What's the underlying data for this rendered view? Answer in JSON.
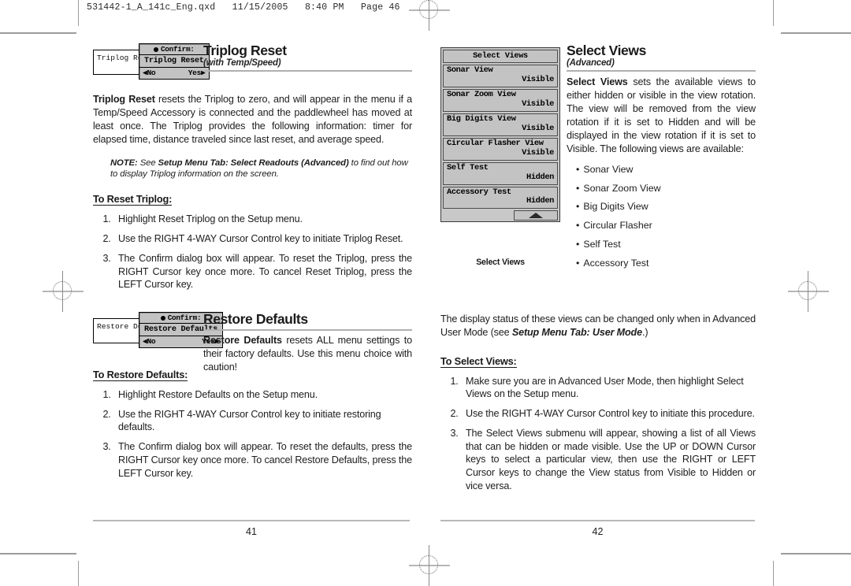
{
  "file_header": "531442-1_A_141c_Eng.qxd   11/15/2005   8:40 PM   Page 46",
  "left_page": {
    "page_number": "41",
    "triplog": {
      "heading": "Triplog Reset",
      "subheading": "(with Temp/Speed)",
      "lcd": {
        "underbox_label": "Triplog Rese",
        "confirm_title": "Confirm:",
        "confirm_body": "Triplog Reset",
        "btn_no": "◀No",
        "btn_yes": "Yes▶"
      },
      "body_bold_lead": "Triplog Reset",
      "body_rest": " resets the Triplog to zero, and will appear in the menu if a Temp/Speed Accessory is connected and the paddlewheel has moved at least once. The Triplog provides the following information: timer for elapsed time, distance traveled since last reset, and average speed.",
      "note_label": "NOTE:",
      "note_plain_1": "  See ",
      "note_bold": "Setup Menu Tab: Select Readouts (Advanced)",
      "note_plain_2": " to find out how to display Triplog information on the screen.",
      "steps_heading": "To Reset Triplog:",
      "steps": [
        "Highlight Reset Triplog on the Setup menu.",
        "Use the RIGHT 4-WAY Cursor Control key to initiate Triplog Reset.",
        "The Confirm dialog box will appear. To reset the Triplog, press the RIGHT Cursor key once more. To cancel Reset Triplog, press the LEFT Cursor key."
      ]
    },
    "restore": {
      "heading": "Restore Defaults",
      "lcd": {
        "underbox_label": "Restore De",
        "confirm_title": "Confirm:",
        "confirm_body": "Restore Defaults",
        "btn_no": "◀No",
        "btn_yes": "Yes▶"
      },
      "body_bold_lead": "Restore Defaults",
      "body_rest": " resets ALL menu settings to their factory defaults. Use this menu choice with caution!",
      "steps_heading": "To Restore Defaults:",
      "steps": [
        "Highlight Restore Defaults on the Setup menu.",
        "Use the RIGHT 4-WAY Cursor Control key to initiate restoring defaults.",
        "The Confirm dialog box will appear. To reset the defaults,  press the RIGHT Cursor key once more. To cancel Restore Defaults, press the LEFT Cursor key."
      ]
    }
  },
  "right_page": {
    "page_number": "42",
    "select_views": {
      "heading": "Select Views",
      "subheading": "(Advanced)",
      "body_bold_lead": "Select Views",
      "body_rest": " sets the available views to either hidden or visible in the view rotation. The view will be removed from the view rotation if it is set to Hidden and will be displayed in the view rotation if it is set to Visible. The following views are available:",
      "view_bullets": [
        "Sonar View",
        "Sonar Zoom View",
        "Big Digits View",
        "Circular Flasher",
        "Self Test",
        "Accessory Test"
      ],
      "lcd": {
        "title": "Select Views",
        "caption": "Select Views",
        "rows": [
          {
            "name": "Sonar View",
            "value": "Visible"
          },
          {
            "name": "Sonar Zoom View",
            "value": "Visible"
          },
          {
            "name": "Big Digits View",
            "value": "Visible"
          },
          {
            "name": "Circular Flasher View",
            "value": "Visible"
          },
          {
            "name": "Self Test",
            "value": "Hidden"
          },
          {
            "name": "Accessory Test",
            "value": "Hidden"
          }
        ],
        "scroll_icon": "scroll-up-arrow"
      },
      "advanced_note_plain_1": "The display status of these views can be changed only when in Advanced User Mode (see ",
      "advanced_note_bold": "Setup Menu Tab: User Mode",
      "advanced_note_plain_2": ".)",
      "steps_heading": "To Select Views:",
      "steps": [
        "Make sure you are in Advanced User Mode, then highlight Select Views on the Setup menu.",
        "Use the RIGHT 4-WAY Cursor Control key to initiate this procedure.",
        "The Select Views submenu will appear, showing a list of all Views that can be hidden or made visible. Use the UP or DOWN Cursor keys to select a particular view, then use the RIGHT or LEFT Cursor keys to change the View status from Visible to Hidden or vice versa."
      ]
    }
  }
}
